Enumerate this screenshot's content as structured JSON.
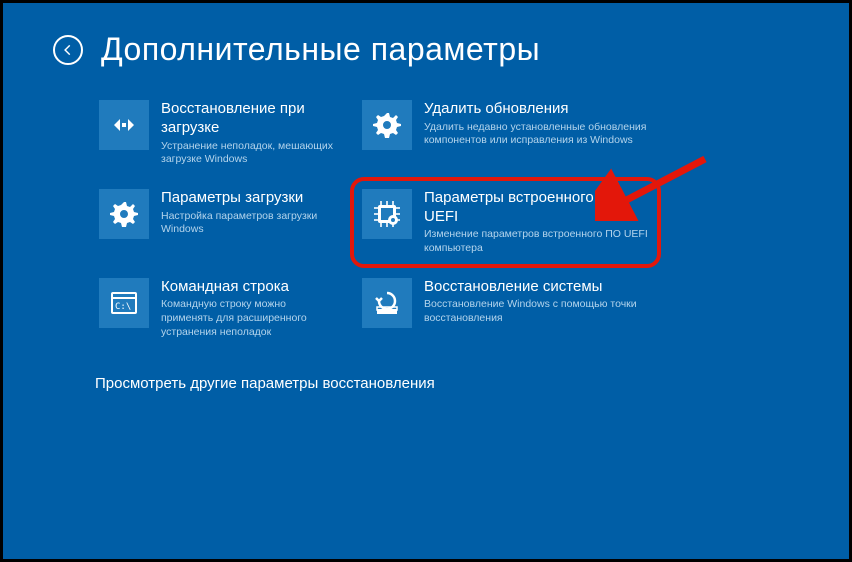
{
  "header": {
    "title": "Дополнительные параметры"
  },
  "tiles": {
    "startup_repair": {
      "title": "Восстановление при загрузке",
      "desc": "Устранение неполадок, мешающих загрузке Windows"
    },
    "uninstall_updates": {
      "title": "Удалить обновления",
      "desc": "Удалить недавно установленные обновления компонентов или исправления из Windows"
    },
    "startup_settings": {
      "title": "Параметры загрузки",
      "desc": "Настройка параметров загрузки Windows"
    },
    "uefi": {
      "title": "Параметры встроенного ПО UEFI",
      "desc": "Изменение параметров встроенного ПО UEFI компьютера"
    },
    "cmd": {
      "title": "Командная строка",
      "desc": "Командную строку можно применять для расширенного устранения неполадок"
    },
    "system_restore": {
      "title": "Восстановление системы",
      "desc": "Восстановление Windows с помощью точки восстановления"
    }
  },
  "more_link": "Просмотреть другие параметры восстановления"
}
